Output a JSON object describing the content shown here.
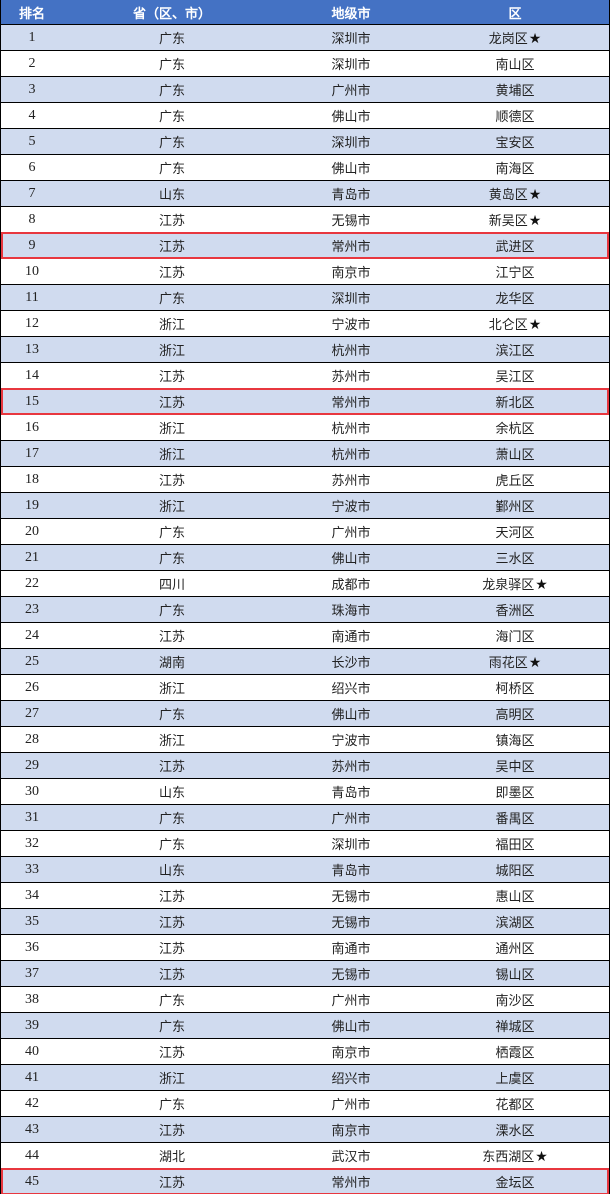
{
  "header": {
    "rank": "排名",
    "province": "省（区、市）",
    "city": "地级市",
    "district": "区"
  },
  "colors": {
    "header_bg": "#4472C4",
    "alt_row_bg": "#D0DBEF",
    "highlight_border": "#E8373F"
  },
  "star_glyph": "★",
  "rows": [
    {
      "rank": "1",
      "province": "广东",
      "city": "深圳市",
      "district": "龙岗区",
      "star": true,
      "highlight": false
    },
    {
      "rank": "2",
      "province": "广东",
      "city": "深圳市",
      "district": "南山区",
      "star": false,
      "highlight": false
    },
    {
      "rank": "3",
      "province": "广东",
      "city": "广州市",
      "district": "黄埔区",
      "star": false,
      "highlight": false
    },
    {
      "rank": "4",
      "province": "广东",
      "city": "佛山市",
      "district": "顺德区",
      "star": false,
      "highlight": false
    },
    {
      "rank": "5",
      "province": "广东",
      "city": "深圳市",
      "district": "宝安区",
      "star": false,
      "highlight": false
    },
    {
      "rank": "6",
      "province": "广东",
      "city": "佛山市",
      "district": "南海区",
      "star": false,
      "highlight": false
    },
    {
      "rank": "7",
      "province": "山东",
      "city": "青岛市",
      "district": "黄岛区",
      "star": true,
      "highlight": false
    },
    {
      "rank": "8",
      "province": "江苏",
      "city": "无锡市",
      "district": "新吴区",
      "star": true,
      "highlight": false
    },
    {
      "rank": "9",
      "province": "江苏",
      "city": "常州市",
      "district": "武进区",
      "star": false,
      "highlight": true
    },
    {
      "rank": "10",
      "province": "江苏",
      "city": "南京市",
      "district": "江宁区",
      "star": false,
      "highlight": false
    },
    {
      "rank": "11",
      "province": "广东",
      "city": "深圳市",
      "district": "龙华区",
      "star": false,
      "highlight": false
    },
    {
      "rank": "12",
      "province": "浙江",
      "city": "宁波市",
      "district": "北仑区",
      "star": true,
      "highlight": false
    },
    {
      "rank": "13",
      "province": "浙江",
      "city": "杭州市",
      "district": "滨江区",
      "star": false,
      "highlight": false
    },
    {
      "rank": "14",
      "province": "江苏",
      "city": "苏州市",
      "district": "吴江区",
      "star": false,
      "highlight": false
    },
    {
      "rank": "15",
      "province": "江苏",
      "city": "常州市",
      "district": "新北区",
      "star": false,
      "highlight": true
    },
    {
      "rank": "16",
      "province": "浙江",
      "city": "杭州市",
      "district": "余杭区",
      "star": false,
      "highlight": false
    },
    {
      "rank": "17",
      "province": "浙江",
      "city": "杭州市",
      "district": "萧山区",
      "star": false,
      "highlight": false
    },
    {
      "rank": "18",
      "province": "江苏",
      "city": "苏州市",
      "district": "虎丘区",
      "star": false,
      "highlight": false
    },
    {
      "rank": "19",
      "province": "浙江",
      "city": "宁波市",
      "district": "鄞州区",
      "star": false,
      "highlight": false
    },
    {
      "rank": "20",
      "province": "广东",
      "city": "广州市",
      "district": "天河区",
      "star": false,
      "highlight": false
    },
    {
      "rank": "21",
      "province": "广东",
      "city": "佛山市",
      "district": "三水区",
      "star": false,
      "highlight": false
    },
    {
      "rank": "22",
      "province": "四川",
      "city": "成都市",
      "district": "龙泉驿区",
      "star": true,
      "highlight": false
    },
    {
      "rank": "23",
      "province": "广东",
      "city": "珠海市",
      "district": "香洲区",
      "star": false,
      "highlight": false
    },
    {
      "rank": "24",
      "province": "江苏",
      "city": "南通市",
      "district": "海门区",
      "star": false,
      "highlight": false
    },
    {
      "rank": "25",
      "province": "湖南",
      "city": "长沙市",
      "district": "雨花区",
      "star": true,
      "highlight": false
    },
    {
      "rank": "26",
      "province": "浙江",
      "city": "绍兴市",
      "district": "柯桥区",
      "star": false,
      "highlight": false
    },
    {
      "rank": "27",
      "province": "广东",
      "city": "佛山市",
      "district": "高明区",
      "star": false,
      "highlight": false
    },
    {
      "rank": "28",
      "province": "浙江",
      "city": "宁波市",
      "district": "镇海区",
      "star": false,
      "highlight": false
    },
    {
      "rank": "29",
      "province": "江苏",
      "city": "苏州市",
      "district": "吴中区",
      "star": false,
      "highlight": false
    },
    {
      "rank": "30",
      "province": "山东",
      "city": "青岛市",
      "district": "即墨区",
      "star": false,
      "highlight": false
    },
    {
      "rank": "31",
      "province": "广东",
      "city": "广州市",
      "district": "番禺区",
      "star": false,
      "highlight": false
    },
    {
      "rank": "32",
      "province": "广东",
      "city": "深圳市",
      "district": "福田区",
      "star": false,
      "highlight": false
    },
    {
      "rank": "33",
      "province": "山东",
      "city": "青岛市",
      "district": "城阳区",
      "star": false,
      "highlight": false
    },
    {
      "rank": "34",
      "province": "江苏",
      "city": "无锡市",
      "district": "惠山区",
      "star": false,
      "highlight": false
    },
    {
      "rank": "35",
      "province": "江苏",
      "city": "无锡市",
      "district": "滨湖区",
      "star": false,
      "highlight": false
    },
    {
      "rank": "36",
      "province": "江苏",
      "city": "南通市",
      "district": "通州区",
      "star": false,
      "highlight": false
    },
    {
      "rank": "37",
      "province": "江苏",
      "city": "无锡市",
      "district": "锡山区",
      "star": false,
      "highlight": false
    },
    {
      "rank": "38",
      "province": "广东",
      "city": "广州市",
      "district": "南沙区",
      "star": false,
      "highlight": false
    },
    {
      "rank": "39",
      "province": "广东",
      "city": "佛山市",
      "district": "禅城区",
      "star": false,
      "highlight": false
    },
    {
      "rank": "40",
      "province": "江苏",
      "city": "南京市",
      "district": "栖霞区",
      "star": false,
      "highlight": false
    },
    {
      "rank": "41",
      "province": "浙江",
      "city": "绍兴市",
      "district": "上虞区",
      "star": false,
      "highlight": false
    },
    {
      "rank": "42",
      "province": "广东",
      "city": "广州市",
      "district": "花都区",
      "star": false,
      "highlight": false
    },
    {
      "rank": "43",
      "province": "江苏",
      "city": "南京市",
      "district": "溧水区",
      "star": false,
      "highlight": false
    },
    {
      "rank": "44",
      "province": "湖北",
      "city": "武汉市",
      "district": "东西湖区",
      "star": true,
      "highlight": false
    },
    {
      "rank": "45",
      "province": "江苏",
      "city": "常州市",
      "district": "金坛区",
      "star": false,
      "highlight": true
    }
  ]
}
